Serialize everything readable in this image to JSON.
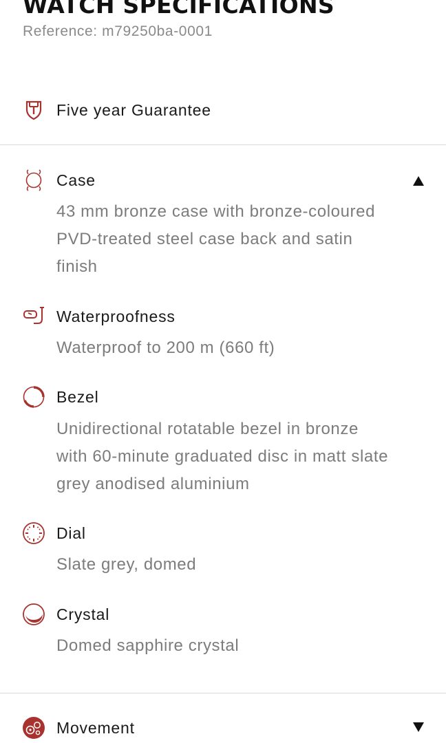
{
  "header": {
    "title": "WATCH SPECIFICATIONS",
    "reference": "Reference: m79250ba-0001"
  },
  "guarantee": {
    "label": "Five year Guarantee",
    "icon": "shield-icon"
  },
  "case_section": {
    "title": "Case",
    "expanded": true,
    "icon": "watch-case-icon",
    "description": "43 mm bronze case with bronze-coloured PVD-treated steel case back and satin finish"
  },
  "specs": [
    {
      "title": "Waterproofness",
      "icon": "snorkel-icon",
      "description": "Waterproof to 200 m (660 ft)"
    },
    {
      "title": "Bezel",
      "icon": "bezel-icon",
      "description": "Unidirectional rotatable bezel in bronze with 60-minute graduated disc in matt slate grey anodised aluminium"
    },
    {
      "title": "Dial",
      "icon": "dial-icon",
      "description": "Slate grey, domed"
    },
    {
      "title": "Crystal",
      "icon": "crystal-icon",
      "description": "Domed sapphire crystal"
    }
  ],
  "movement_section": {
    "title": "Movement",
    "expanded": false,
    "icon": "movement-icon"
  },
  "colors": {
    "accent": "#a8322d",
    "text": "#1a1a1a",
    "muted": "#7c7c7c",
    "divider": "#d9d9d9"
  }
}
